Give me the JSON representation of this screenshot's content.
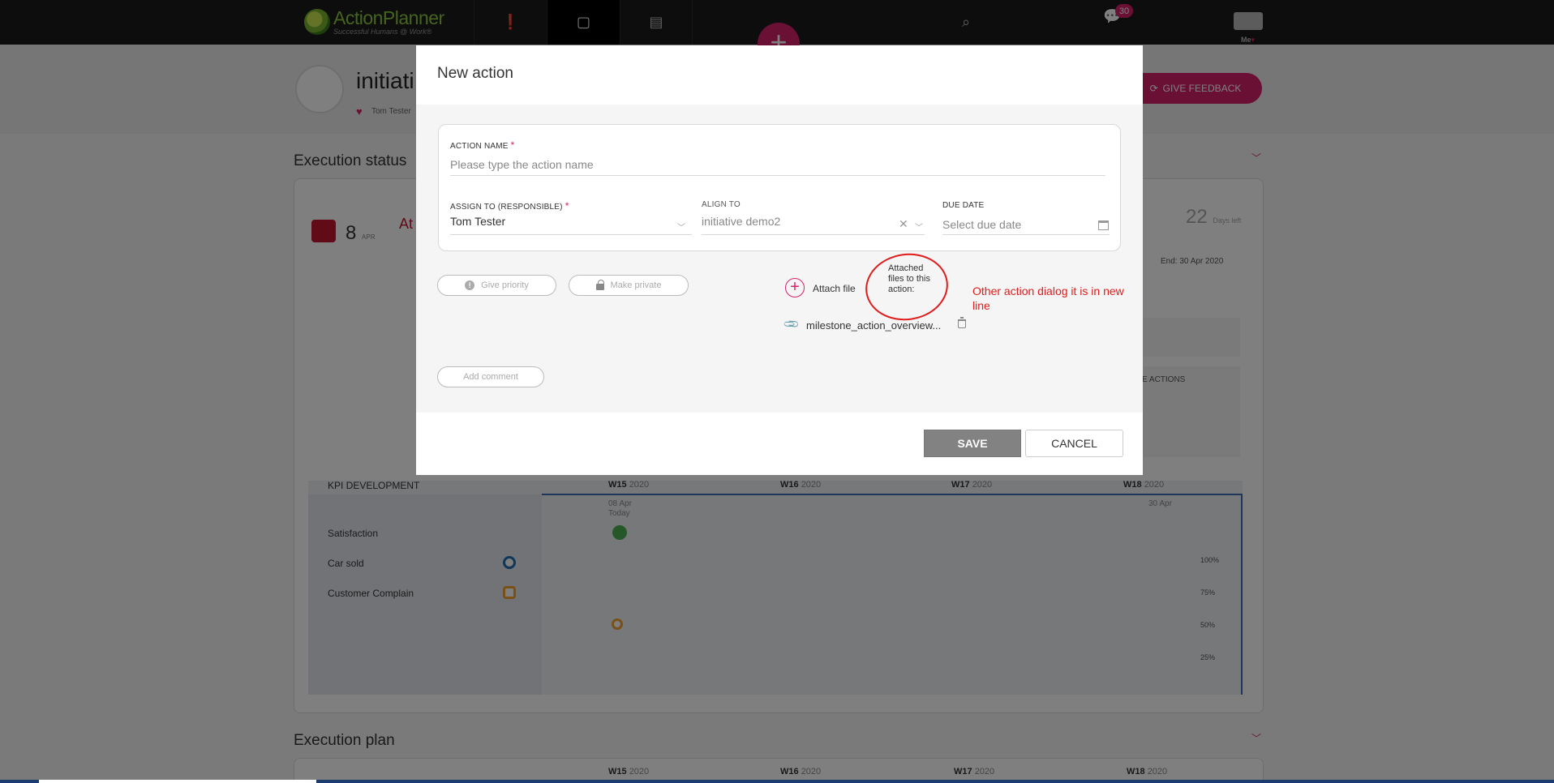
{
  "app": {
    "logo_name": "ActionPlanner",
    "logo_tagline": "Successful Humans @ Work®",
    "notification_count": "30",
    "me_label": "Me",
    "me_caret": "▾"
  },
  "background": {
    "initiative_title": "initiati",
    "owner": "Tom Tester",
    "give_feedback_label": "GIVE FEEDBACK",
    "execution_status_title": "Execution status",
    "execution_plan_title": "Execution plan",
    "status_day": "8",
    "status_month": "APR",
    "status_at": "At",
    "days_left_number": "22",
    "days_left_label": "Days left",
    "end_date": "End: 30 Apr 2020",
    "e_actions_label": "E ACTIONS",
    "kpi_header": "KPI DEVELOPMENT",
    "weeks": [
      {
        "label": "W15",
        "year": "2020"
      },
      {
        "label": "W16",
        "year": "2020"
      },
      {
        "label": "W17",
        "year": "2020"
      },
      {
        "label": "W18",
        "year": "2020"
      }
    ],
    "today_date": "08 Apr",
    "today_label": "Today",
    "end_marker": "30 Apr",
    "kpis": [
      "Satisfaction",
      "Car sold",
      "Customer Complain"
    ],
    "percent_labels": [
      "100%",
      "75%",
      "50%",
      "25%"
    ],
    "colors": {
      "brand": "#d6216a",
      "status_red": "#c0162f",
      "kpi_blue": "#1f6fb2",
      "kpi_orange": "#f0a030"
    }
  },
  "modal": {
    "title": "New action",
    "action_name_label": "ACTION NAME",
    "action_name_placeholder": "Please type the action name",
    "assign_to_label": "ASSIGN TO (RESPONSIBLE)",
    "assign_to_value": "Tom Tester",
    "align_to_label": "ALIGN TO",
    "align_to_value": "initiative demo2",
    "due_date_label": "DUE DATE",
    "due_date_placeholder": "Select due date",
    "required_mark": "*",
    "give_priority_label": "Give priority",
    "make_private_label": "Make private",
    "attach_file_label": "Attach file",
    "attached_files_caption": "Attached files to this action:",
    "attached_file_name": "milestone_action_overview...",
    "add_comment_label": "Add comment",
    "save_label": "SAVE",
    "cancel_label": "CANCEL"
  },
  "annotation": {
    "text": "Other action dialog it is in new line",
    "color": "#e01c1c"
  }
}
